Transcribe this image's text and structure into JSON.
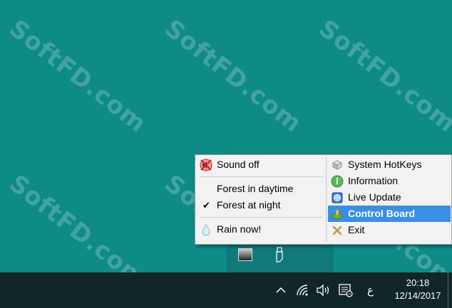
{
  "watermark": "SoftFD.com",
  "menu": {
    "left_items": [
      {
        "label": "Sound off",
        "icon": "speaker-muted-icon",
        "checked": false
      },
      {
        "label": "Forest in daytime",
        "checked": false
      },
      {
        "label": "Forest at night",
        "checked": true
      },
      {
        "label": "Rain now!",
        "icon": "raindrop-icon",
        "checked": false
      }
    ],
    "right_items": [
      {
        "label": "System HotKeys",
        "icon": "hotkeys-icon"
      },
      {
        "label": "Information",
        "icon": "info-icon"
      },
      {
        "label": "Live Update",
        "icon": "globe-update-icon"
      },
      {
        "label": "Control Board",
        "icon": "control-board-icon",
        "highlighted": true
      },
      {
        "label": "Exit",
        "icon": "exit-icon"
      }
    ],
    "check_glyph": "✔"
  },
  "taskbar": {
    "input_indicator": "ع",
    "time": "20:18",
    "date": "12/14/2017"
  },
  "colors": {
    "desktop": "#0e8a87",
    "taskbar": "#102628",
    "menu_bg": "#f2f2f2",
    "highlight": "#3a8ee6"
  }
}
